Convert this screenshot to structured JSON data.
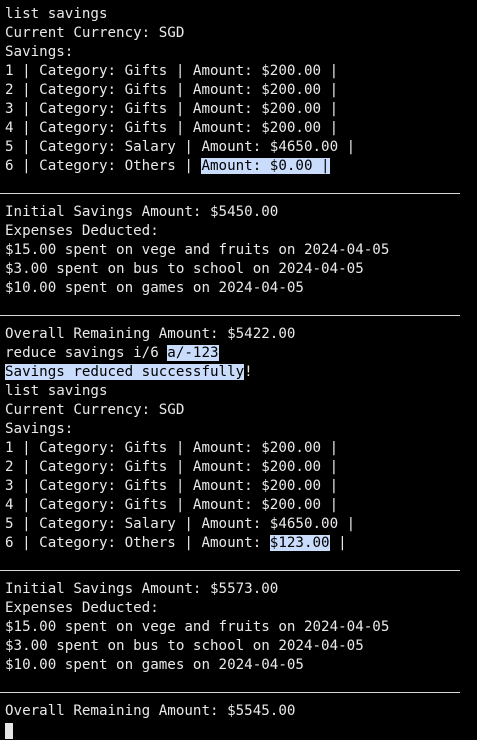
{
  "terminal": {
    "top_partial": "...",
    "block1": {
      "command": "list savings",
      "currency": "Current Currency: SGD",
      "savings_header": "Savings:",
      "rows": [
        "1 | Category: Gifts | Amount: $200.00 |",
        "2 | Category: Gifts | Amount: $200.00 |",
        "3 | Category: Gifts | Amount: $200.00 |",
        "4 | Category: Gifts | Amount: $200.00 |",
        "5 | Category: Salary | Amount: $4650.00 |"
      ],
      "row6_prefix": "6 | Category: Others | ",
      "row6_highlight": "Amount: $0.00 |",
      "initial": "Initial Savings Amount: $5450.00",
      "expenses_header": "Expenses Deducted:",
      "expenses": [
        "$15.00 spent on vege and fruits on 2024-04-05",
        "$3.00 spent on bus to school on 2024-04-05",
        "$10.00 spent on games on 2024-04-05"
      ],
      "overall": "Overall Remaining Amount: $5422.00"
    },
    "reduce_command_prefix": "reduce savings i/6 ",
    "reduce_command_highlight": "a/-123",
    "reduce_result_highlight": "Savings reduced successfully",
    "reduce_result_suffix": "!",
    "block2": {
      "command": "list savings",
      "currency": "Current Currency: SGD",
      "savings_header": "Savings:",
      "rows": [
        "1 | Category: Gifts | Amount: $200.00 |",
        "2 | Category: Gifts | Amount: $200.00 |",
        "3 | Category: Gifts | Amount: $200.00 |",
        "4 | Category: Gifts | Amount: $200.00 |",
        "5 | Category: Salary | Amount: $4650.00 |"
      ],
      "row6_prefix": "6 | Category: Others | Amount: ",
      "row6_highlight": "$123.00",
      "row6_suffix": " |",
      "initial": "Initial Savings Amount: $5573.00",
      "expenses_header": "Expenses Deducted:",
      "expenses": [
        "$15.00 spent on vege and fruits on 2024-04-05",
        "$3.00 spent on bus to school on 2024-04-05",
        "$10.00 spent on games on 2024-04-05"
      ],
      "overall": "Overall Remaining Amount: $5545.00"
    }
  },
  "colors": {
    "background": "#000000",
    "text": "#e9e9e9",
    "selection": "#c9dcfb",
    "rule": "#d8d8d8"
  }
}
